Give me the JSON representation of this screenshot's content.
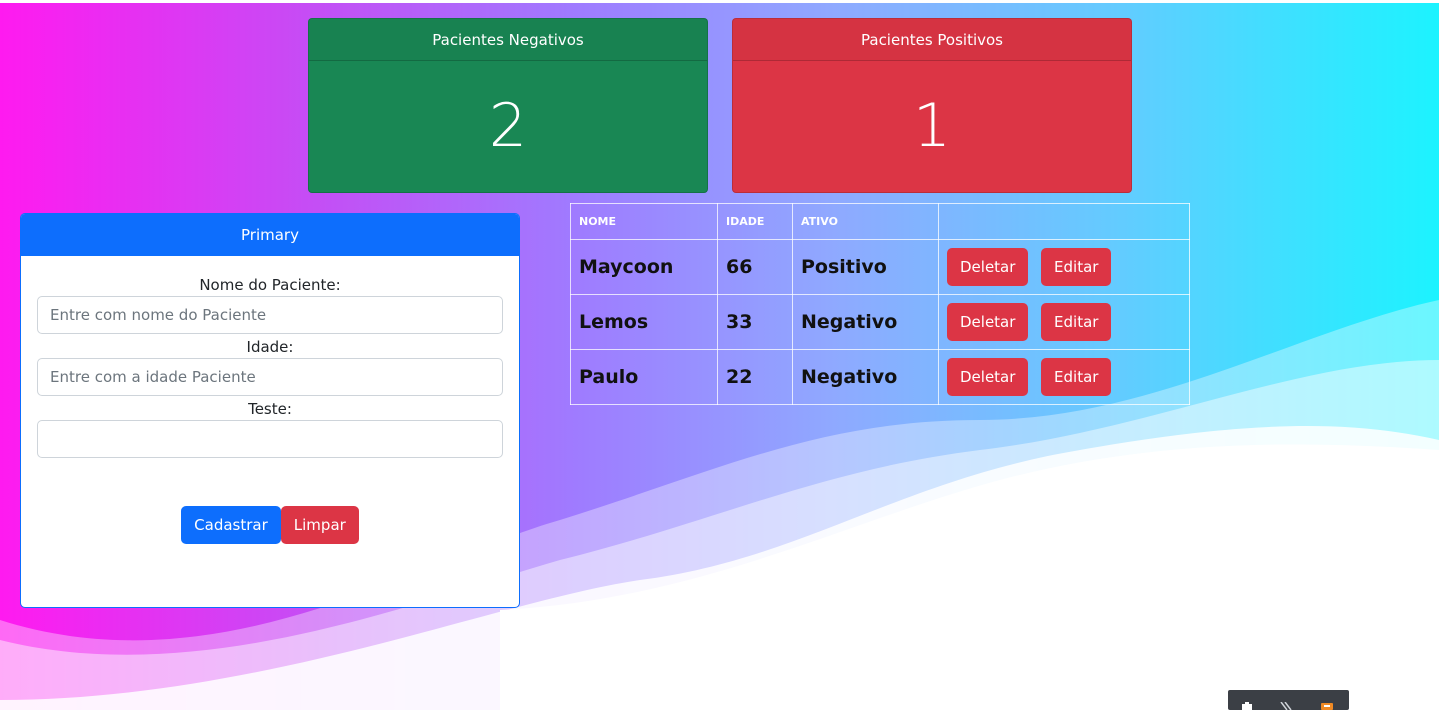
{
  "cards": {
    "negative": {
      "title": "Pacientes Negativos",
      "count": "2",
      "color": "#198754"
    },
    "positive": {
      "title": "Pacientes Positivos",
      "count": "1",
      "color": "#dc3545"
    }
  },
  "form": {
    "header": "Primary",
    "name_label": "Nome do Paciente:",
    "name_placeholder": "Entre com nome do Paciente",
    "name_value": "",
    "age_label": "Idade:",
    "age_placeholder": "Entre com a idade Paciente",
    "age_value": "",
    "test_label": "Teste:",
    "test_value": "",
    "submit_label": "Cadastrar",
    "clear_label": "Limpar"
  },
  "table": {
    "headers": [
      "NOME",
      "IDADE",
      "ATIVO",
      ""
    ],
    "rows": [
      {
        "nome": "Maycoon",
        "idade": "66",
        "ativo": "Positivo"
      },
      {
        "nome": "Lemos",
        "idade": "33",
        "ativo": "Negativo"
      },
      {
        "nome": "Paulo",
        "idade": "22",
        "ativo": "Negativo"
      }
    ],
    "delete_label": "Deletar",
    "edit_label": "Editar"
  },
  "colors": {
    "primary": "#0d6efd",
    "danger": "#dc3545",
    "success": "#198754"
  },
  "taskbar_icons": [
    "shield-icon",
    "chevrons-icon",
    "app-icon"
  ]
}
